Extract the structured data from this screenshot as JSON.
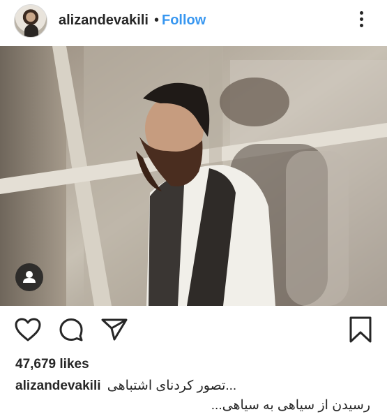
{
  "post": {
    "username": "alizandevakili",
    "separator": "•",
    "follow_label": "Follow",
    "more_icon": "more-vertical-icon"
  },
  "actions": {
    "like_icon": "heart-icon",
    "comment_icon": "comment-icon",
    "share_icon": "send-icon",
    "save_icon": "bookmark-icon"
  },
  "stats": {
    "likes": "47,679 likes"
  },
  "caption": {
    "username": "alizandevakili",
    "line1": "...تصور کردنای اشتباهی",
    "line2": "رسیدن از سیاهی به سیاهی..."
  },
  "colors": {
    "link": "#3897f0",
    "text": "#262626"
  }
}
